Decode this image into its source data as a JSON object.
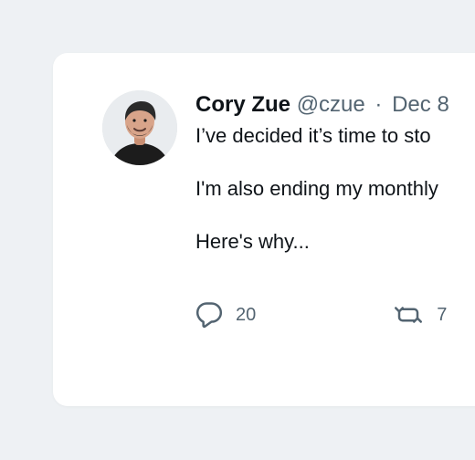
{
  "tweet": {
    "author_name": "Cory Zue",
    "author_handle": "@czue",
    "separator": "·",
    "date": "Dec 8",
    "paragraphs": [
      "I’ve decided it’s time to sto",
      "I'm also ending my monthly",
      "Here's why..."
    ],
    "actions": {
      "reply_count": "20",
      "retweet_count": "7"
    }
  },
  "icons": {
    "reply": "reply-icon",
    "retweet": "retweet-icon"
  }
}
